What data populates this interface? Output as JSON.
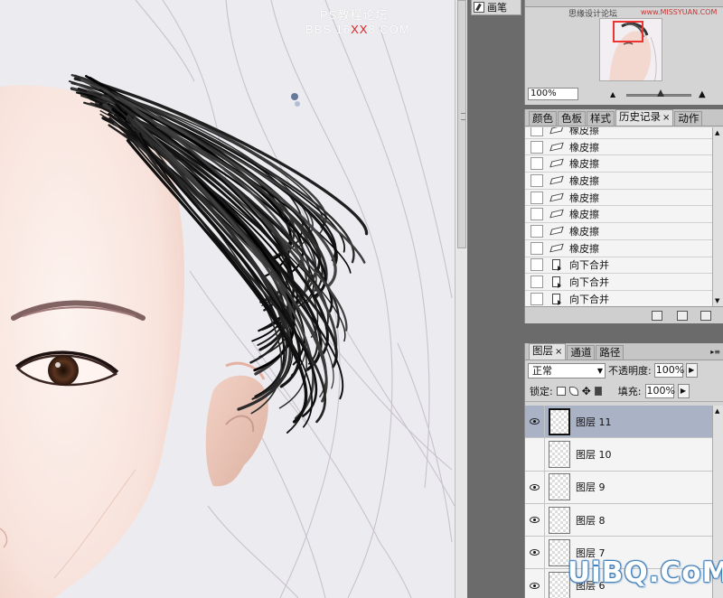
{
  "canvas": {
    "watermark_line1": "PS教程论坛",
    "watermark_line2_pre": "BBS.16",
    "watermark_line2_red": "XX",
    "watermark_line2_post": "8.COM"
  },
  "brush_tab": {
    "label": "画笔",
    "icon": "brush-icon"
  },
  "navigator": {
    "watermark": "思缘设计论坛",
    "watermark_url": "www.MISSYUAN.COM",
    "zoom": "100%"
  },
  "history_panel": {
    "tabs": [
      {
        "label": "颜色",
        "active": false
      },
      {
        "label": "色板",
        "active": false
      },
      {
        "label": "样式",
        "active": false
      },
      {
        "label": "历史记录",
        "active": true,
        "close": "×"
      },
      {
        "label": "动作",
        "active": false
      }
    ],
    "items": [
      {
        "label": "橡皮擦",
        "icon": "eraser-icon"
      },
      {
        "label": "橡皮擦",
        "icon": "eraser-icon"
      },
      {
        "label": "橡皮擦",
        "icon": "eraser-icon"
      },
      {
        "label": "橡皮擦",
        "icon": "eraser-icon"
      },
      {
        "label": "橡皮擦",
        "icon": "eraser-icon"
      },
      {
        "label": "橡皮擦",
        "icon": "eraser-icon"
      },
      {
        "label": "橡皮擦",
        "icon": "eraser-icon"
      },
      {
        "label": "橡皮擦",
        "icon": "eraser-icon"
      },
      {
        "label": "向下合并",
        "icon": "merge-down-icon"
      },
      {
        "label": "向下合并",
        "icon": "merge-down-icon"
      },
      {
        "label": "向下合并",
        "icon": "merge-down-icon"
      },
      {
        "label": "向下合并",
        "icon": "merge-down-icon",
        "selected": true
      }
    ]
  },
  "layers_panel": {
    "tabs": [
      {
        "label": "图层",
        "active": true,
        "close": "×"
      },
      {
        "label": "通道",
        "active": false
      },
      {
        "label": "路径",
        "active": false
      }
    ],
    "blend_mode": "正常",
    "opacity_label": "不透明度:",
    "opacity": "100%",
    "lock_label": "锁定:",
    "fill_label": "填充:",
    "fill": "100%",
    "layers": [
      {
        "name": "图层 11",
        "visible": true,
        "selected": true
      },
      {
        "name": "图层 10",
        "visible": false
      },
      {
        "name": "图层 9",
        "visible": true
      },
      {
        "name": "图层 8",
        "visible": true
      },
      {
        "name": "图层 7",
        "visible": true
      },
      {
        "name": "图层 6",
        "visible": true
      }
    ]
  },
  "site_logo": "UiBQ.CoM",
  "colors": {
    "panel_bg": "#d4d4d4",
    "selection": "#aab2c6",
    "workspace": "#6b6b6b"
  }
}
